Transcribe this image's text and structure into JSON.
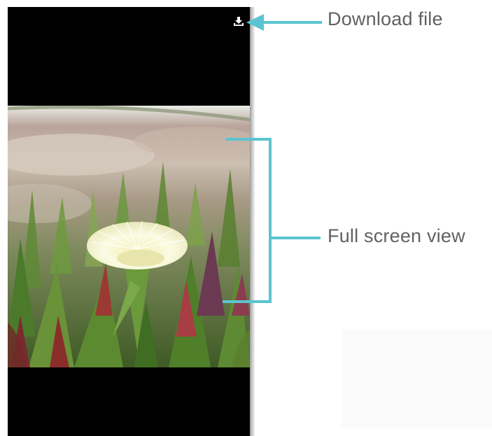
{
  "viewer": {
    "download_icon": "download-icon",
    "image_subject": "photo"
  },
  "annotations": {
    "download_label": "Download file",
    "fullscreen_label": "Full screen view"
  },
  "colors": {
    "callout": "#5bc4d1",
    "label_text": "#616161",
    "viewer_background": "#000000"
  }
}
